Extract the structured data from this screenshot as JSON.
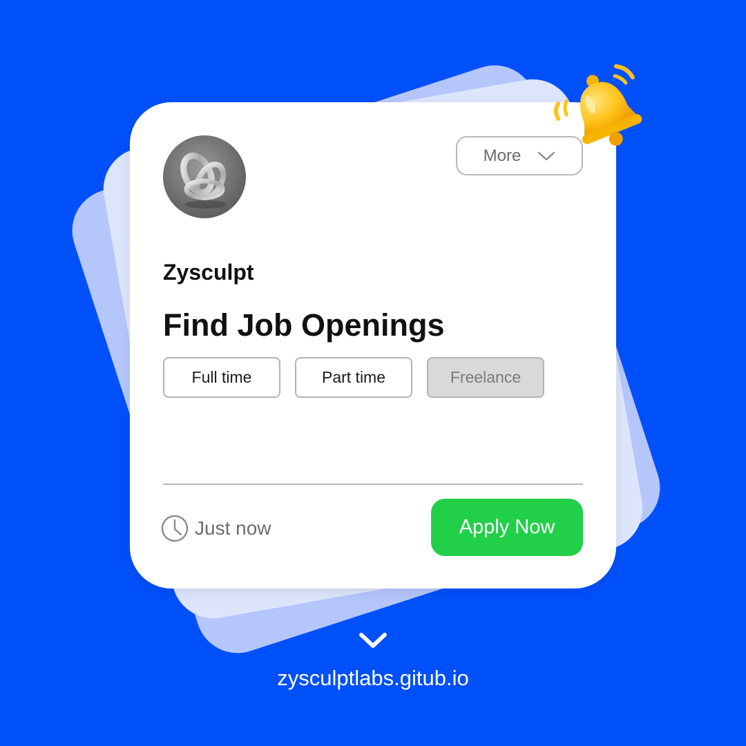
{
  "company": {
    "name": "Zysculpt",
    "logo_icon": "chrome-rings-logo"
  },
  "card": {
    "headline": "Find Job Openings",
    "more_label": "More",
    "tags": [
      {
        "label": "Full time",
        "active": true
      },
      {
        "label": "Part time",
        "active": true
      },
      {
        "label": "Freelance",
        "active": false
      }
    ],
    "time_label": "Just now",
    "apply_label": "Apply Now"
  },
  "footer": {
    "url": "zysculptlabs.gitub.io"
  },
  "icons": {
    "bell": "bell-icon",
    "clock": "clock-icon",
    "chevron": "chevron-down-icon"
  },
  "colors": {
    "background": "#0050fa",
    "card": "#ffffff",
    "apply": "#22cf48",
    "back_card_1": "#b5c6fb",
    "back_card_2": "#dde5fd",
    "disabled_tag": "#d9d9d9"
  }
}
